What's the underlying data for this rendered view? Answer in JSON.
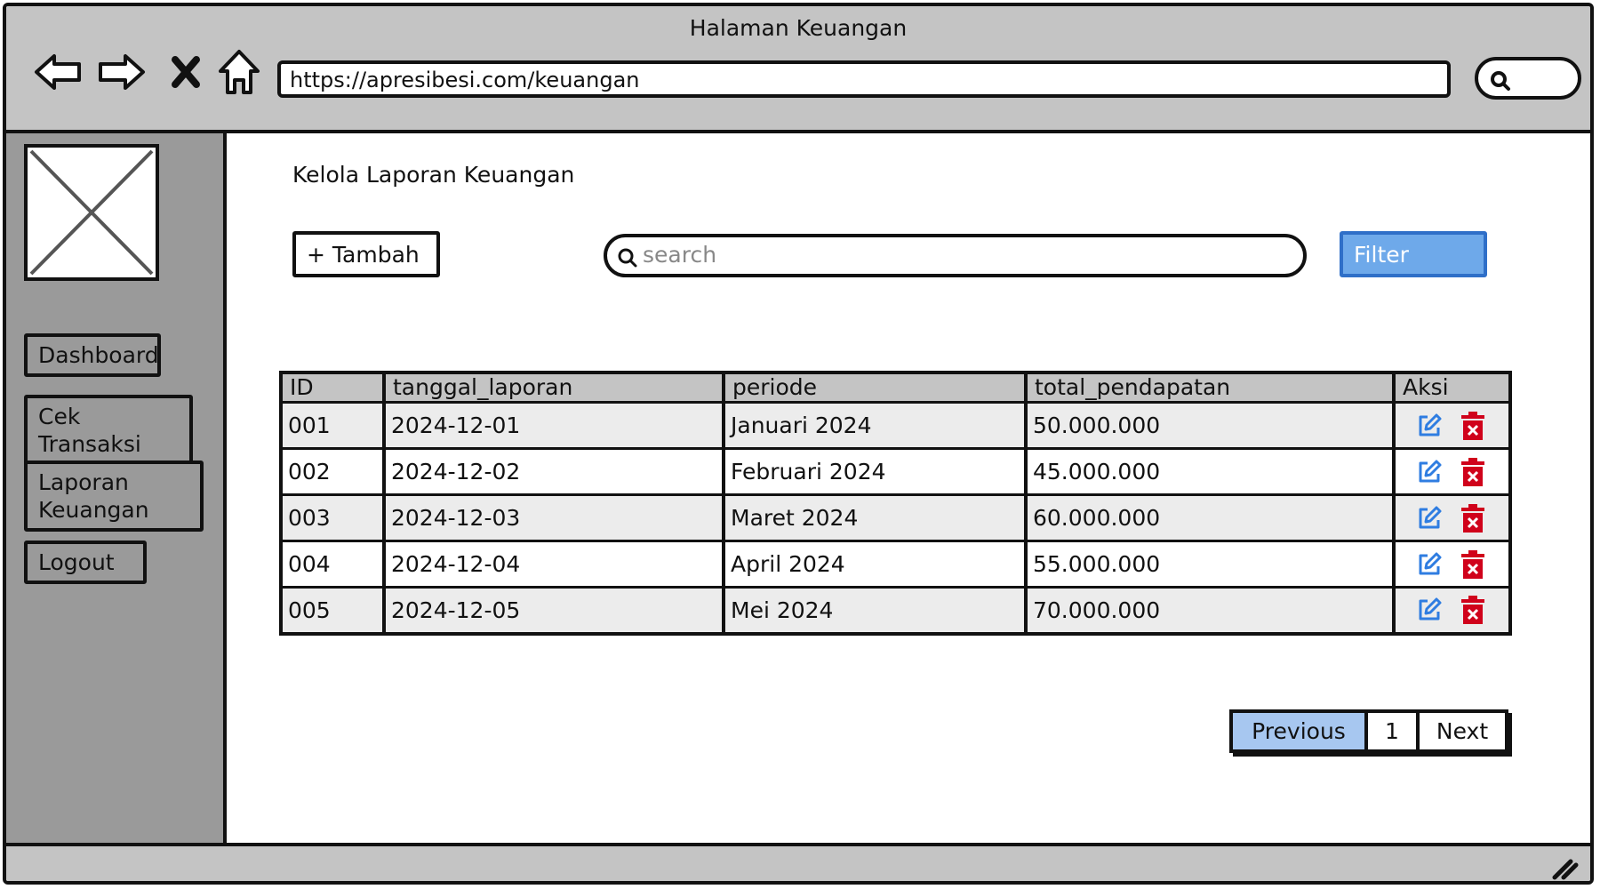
{
  "browser": {
    "title": "Halaman Keuangan",
    "url": "https://apresibesi.com/keuangan"
  },
  "sidebar": {
    "items": [
      {
        "label": "Dashboard"
      },
      {
        "label": "Cek Transaksi"
      },
      {
        "label": "Laporan Keuangan"
      },
      {
        "label": "Logout"
      }
    ]
  },
  "main": {
    "title": "Kelola Laporan Keuangan",
    "add_label": "+ Tambah",
    "search_placeholder": "search",
    "filter_label": "Filter"
  },
  "table": {
    "headers": [
      "ID",
      "tanggal_laporan",
      "periode",
      "total_pendapatan",
      "Aksi"
    ],
    "rows": [
      {
        "id": "001",
        "tanggal": "2024-12-01",
        "periode": "Januari 2024",
        "total": "50.000.000"
      },
      {
        "id": "002",
        "tanggal": "2024-12-02",
        "periode": "Februari 2024",
        "total": "45.000.000"
      },
      {
        "id": "003",
        "tanggal": "2024-12-03",
        "periode": "Maret 2024",
        "total": "60.000.000"
      },
      {
        "id": "004",
        "tanggal": "2024-12-04",
        "periode": "April 2024",
        "total": "55.000.000"
      },
      {
        "id": "005",
        "tanggal": "2024-12-05",
        "periode": "Mei 2024",
        "total": "70.000.000"
      }
    ]
  },
  "pagination": {
    "previous": "Previous",
    "page": "1",
    "next": "Next"
  },
  "icons": {
    "back": "back-arrow-icon",
    "forward": "forward-arrow-icon",
    "stop": "close-icon",
    "home": "home-icon",
    "search": "search-icon",
    "edit": "edit-icon",
    "delete": "trash-icon",
    "logo_placeholder": "image-placeholder-icon",
    "resize": "resize-grip-icon"
  },
  "colors": {
    "chrome": "#c4c4c4",
    "sidebar": "#9a9a9a",
    "filter": "#6ea9ea",
    "prev": "#a7c7f0",
    "edit": "#2f7de1",
    "delete": "#d0021b"
  }
}
